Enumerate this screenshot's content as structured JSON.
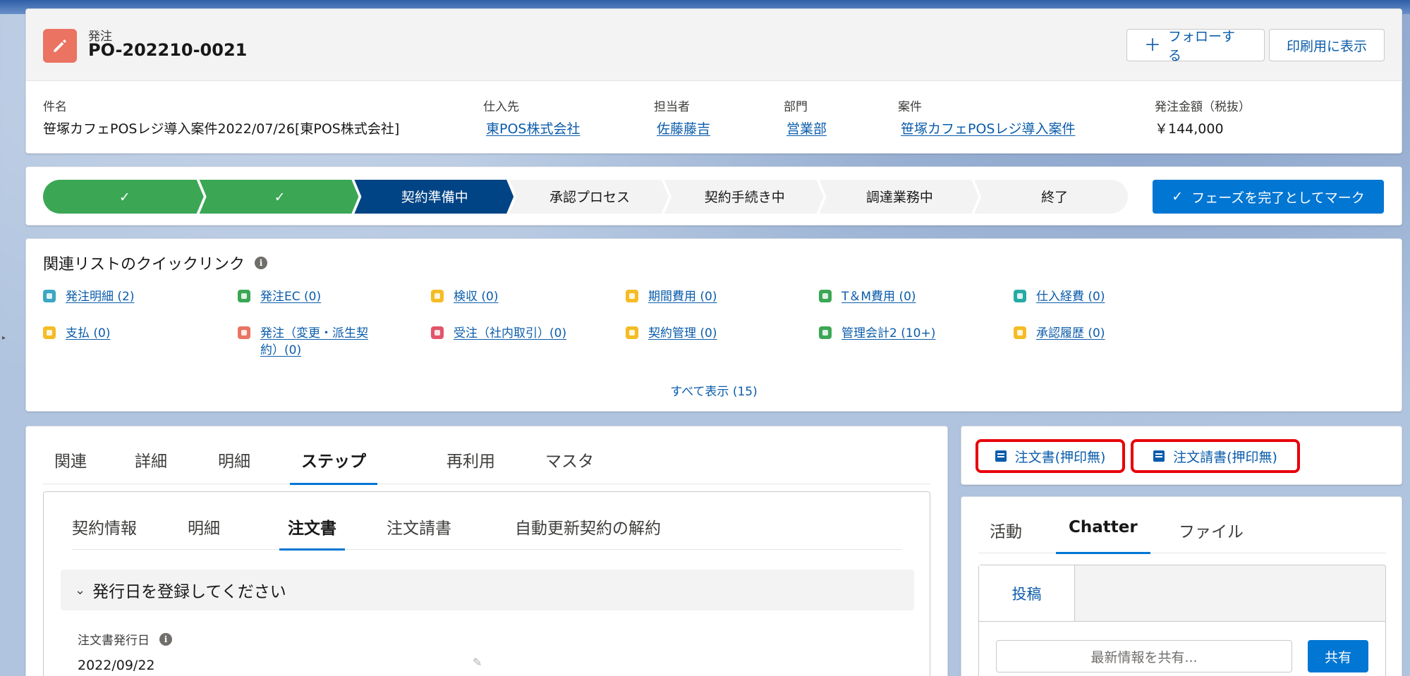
{
  "header": {
    "object_type": "発注",
    "record_name": "PO-202210-0021",
    "follow_label": "フォローする",
    "print_label": "印刷用に表示",
    "fields": [
      {
        "label": "件名",
        "value": "笹塚カフェPOSレジ導入案件2022/07/26[東POS株式会社]",
        "link": false
      },
      {
        "label": "仕入先",
        "value": "東POS株式会社",
        "link": true
      },
      {
        "label": "担当者",
        "value": "佐藤藤吉",
        "link": true
      },
      {
        "label": "部門",
        "value": "営業部",
        "link": true
      },
      {
        "label": "案件",
        "value": "笹塚カフェPOSレジ導入案件",
        "link": true
      },
      {
        "label": "発注金額（税抜）",
        "value": "￥144,000",
        "link": false
      }
    ]
  },
  "path": {
    "stages": [
      {
        "label": "",
        "state": "complete"
      },
      {
        "label": "",
        "state": "complete"
      },
      {
        "label": "契約準備中",
        "state": "current"
      },
      {
        "label": "承認プロセス",
        "state": "incomplete"
      },
      {
        "label": "契約手続き中",
        "state": "incomplete"
      },
      {
        "label": "調達業務中",
        "state": "incomplete"
      },
      {
        "label": "終了",
        "state": "incomplete"
      }
    ],
    "complete_color": "#3ba755",
    "current_color": "#014486",
    "incomplete_color": "#f3f3f3",
    "mark_button_label": "フェーズを完了としてマーク"
  },
  "quick_links": {
    "title": "関連リストのクイックリンク",
    "items": [
      {
        "label": "発注明細 (2)",
        "icon": "wrench-icon",
        "color": "#3ba7c4"
      },
      {
        "label": "発注EC (0)",
        "icon": "upload-icon",
        "color": "#3ba755"
      },
      {
        "label": "検収 (0)",
        "icon": "check-icon",
        "color": "#f4bc25"
      },
      {
        "label": "期間費用 (0)",
        "icon": "circle-icon",
        "color": "#f4bc25"
      },
      {
        "label": "T＆M費用 (0)",
        "icon": "truck-icon",
        "color": "#3ba755"
      },
      {
        "label": "仕入経費 (0)",
        "icon": "money-icon",
        "color": "#26aba4"
      },
      {
        "label": "支払 (0)",
        "icon": "card-icon",
        "color": "#f4bc25"
      },
      {
        "label": "発注（変更・派生契約）(0)",
        "line1": "発注（変更・派生契",
        "line2": "約）(0)",
        "icon": "pencil-icon",
        "color": "#ea7362"
      },
      {
        "label": "受注（社内取引）(0)",
        "icon": "music-icon",
        "color": "#e3546a"
      },
      {
        "label": "契約管理 (0)",
        "icon": "folder-icon",
        "color": "#f4bc25"
      },
      {
        "label": "管理会計2 (10+)",
        "icon": "flag-icon",
        "color": "#3ba755"
      },
      {
        "label": "承認履歴 (0)",
        "icon": "person-icon",
        "color": "#f4bc25"
      }
    ],
    "show_all": "すべて表示 (15)"
  },
  "main_tabs": {
    "tabs": [
      "関連",
      "詳細",
      "明細",
      "ステップ",
      "再利用",
      "マスタ"
    ],
    "active": "ステップ",
    "subtabs": [
      "契約情報",
      "明細",
      "注文書",
      "注文請書",
      "自動更新契約の解約"
    ],
    "active_subtab": "注文書",
    "section_title": "発行日を登録してください",
    "field_label": "注文書発行日",
    "field_value": "2022/09/22"
  },
  "doc_buttons": {
    "order_label": "注文書(押印無)",
    "acceptance_label": "注文請書(押印無)",
    "highlight_color": "#e8000b"
  },
  "side_panel": {
    "tabs": [
      "活動",
      "Chatter",
      "ファイル"
    ],
    "active": "Chatter",
    "publisher_tab": "投稿",
    "share_placeholder": "最新情報を共有...",
    "share_button": "共有"
  }
}
